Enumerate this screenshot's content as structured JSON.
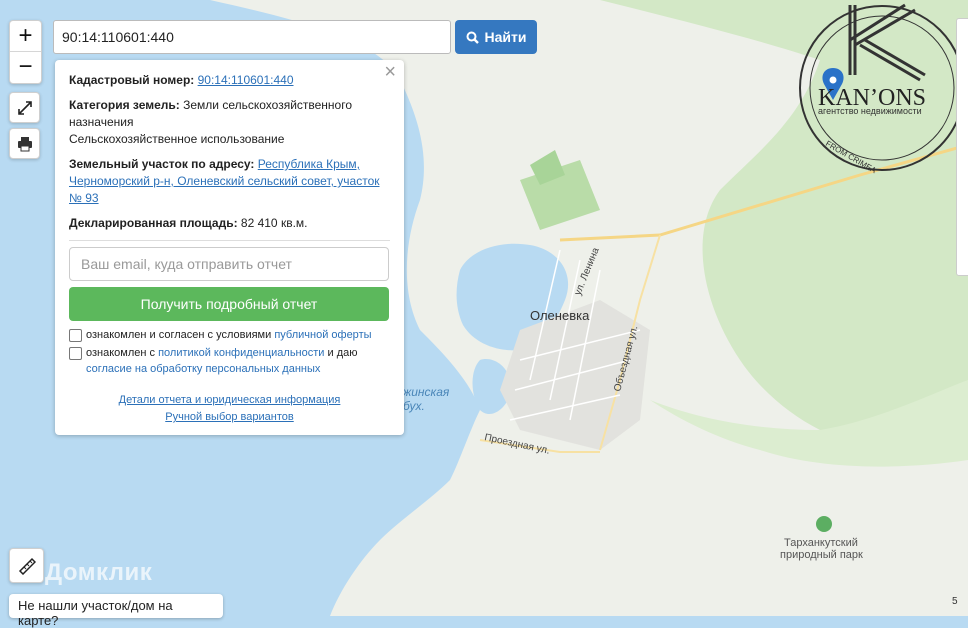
{
  "search": {
    "value": "90:14:110601:440",
    "button_label": "Найти"
  },
  "zoom": {
    "in": "+",
    "out": "−"
  },
  "info": {
    "cad_label": "Кадастровый номер:",
    "cad_value": "90:14:110601:440",
    "cat_label": "Категория земель:",
    "cat_value": "Земли сельскохозяйственного назначения",
    "cat_use": "Сельскохозяйственное использование",
    "addr_label": "Земельный участок по адресу:",
    "addr_value": "Республика Крым, Черноморский р-н, Оленевский сельский совет, участок № 93",
    "area_label": "Декларированная площадь:",
    "area_value": "82 410 кв.м.",
    "email_placeholder": "Ваш email, куда отправить отчет",
    "report_button": "Получить подробный отчет",
    "check1_text": "ознакомлен и согласен с условиями",
    "check1_link": "публичной оферты",
    "check2_text": "ознакомлен с",
    "check2_link": "политикой конфиденциальности",
    "check2_text2": "и даю",
    "check2_link2": "согласие на обработку персональных данных",
    "details_link": "Детали отчета и юридическая информация",
    "manual_link": "Ручной выбор вариантов"
  },
  "map_labels": {
    "town": "Оленевка",
    "street_lenina": "ул. Ленина",
    "street_obezd": "Объездная ул.",
    "street_proezd": "Проездная ул.",
    "bay_1": "жинская",
    "bay_2": "бух.",
    "park_1": "Тарханкутский",
    "park_2": "природный парк",
    "brand": "Домклик"
  },
  "logo": {
    "name": "KAN’ONS",
    "tagline": "агентство недвижимости",
    "arc": "FROM CRIMEA"
  },
  "not_found": "Не нашли участок/дом на карте?",
  "scale_text": "5",
  "colors": {
    "water": "#b8daf2",
    "land": "#eef0ea",
    "forest": "#d3e8c6",
    "road": "#f7d98a",
    "primary": "#3578c0",
    "success": "#5cb85c"
  }
}
